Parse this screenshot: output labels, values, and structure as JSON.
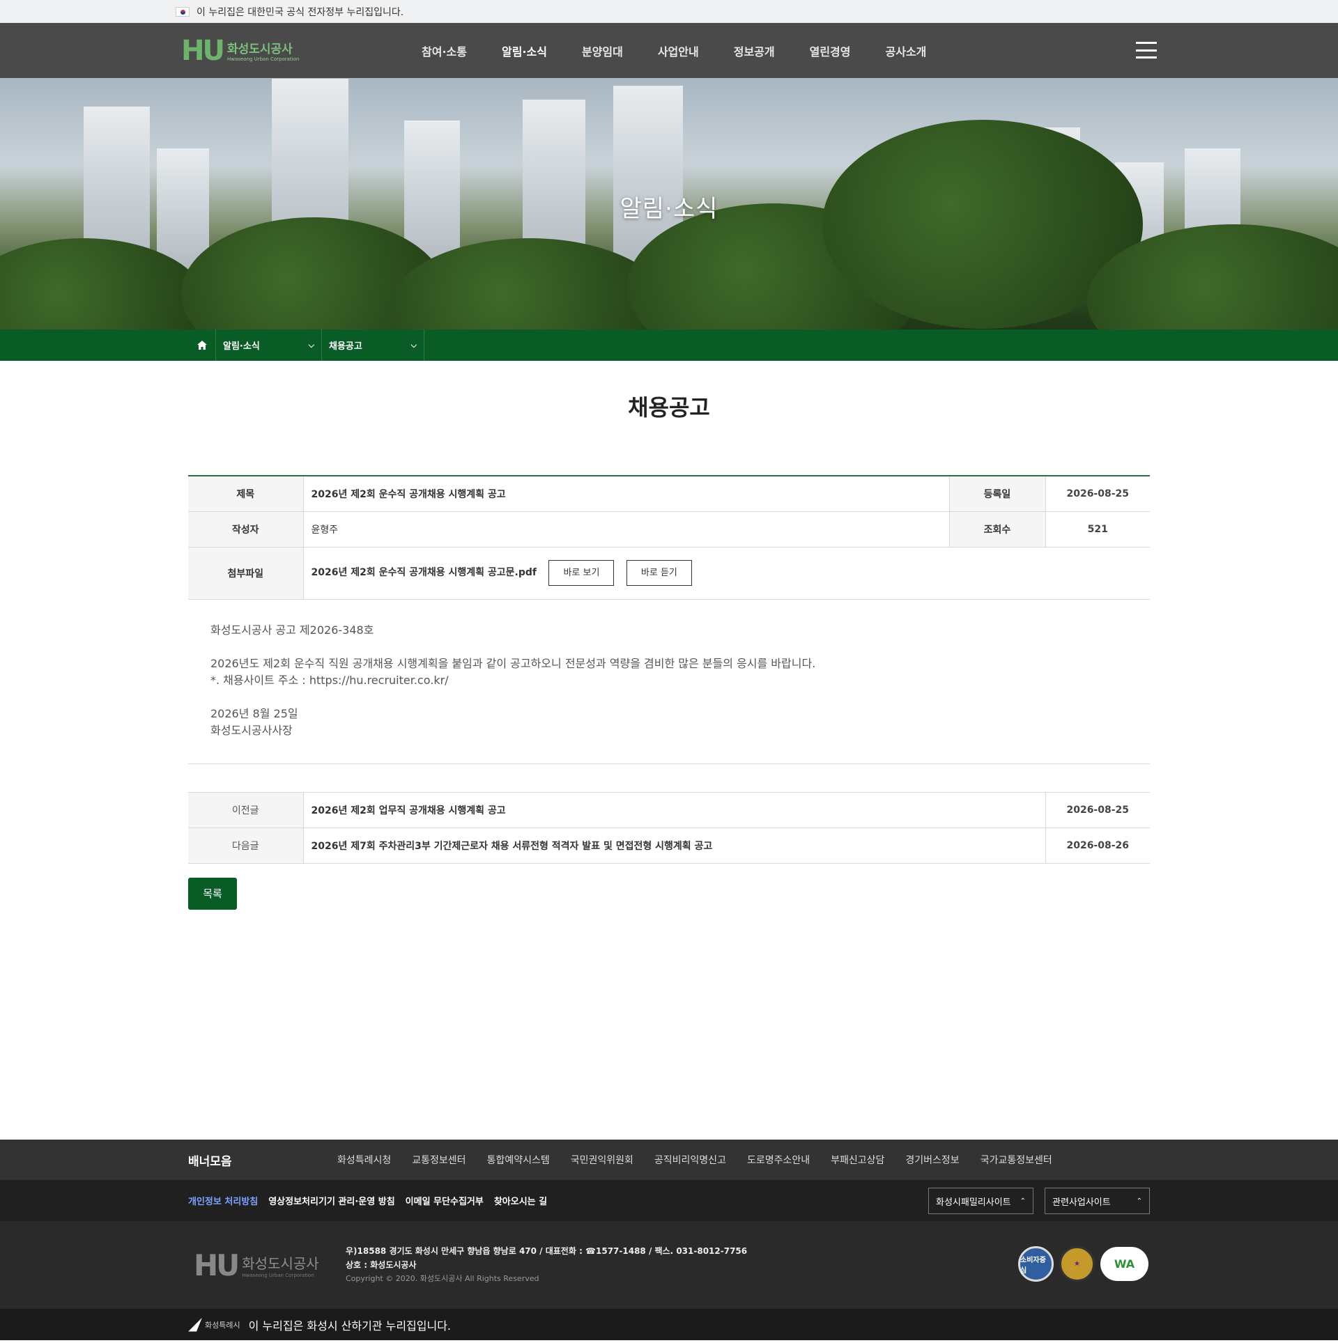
{
  "gov_banner": {
    "text": "이 누리집은 대한민국 공식 전자정부 누리집입니다."
  },
  "header": {
    "logo_mark": "HU",
    "logo_ko": "화성도시공사",
    "logo_en": "Hwaseong Urban Corporation",
    "menu": [
      "참여·소통",
      "알림·소식",
      "분양임대",
      "사업안내",
      "정보공개",
      "열린경영",
      "공사소개"
    ],
    "active_menu": "알림·소식"
  },
  "hero": {
    "title": "알림·소식"
  },
  "location": {
    "level1": "알림·소식",
    "level2": "채용공고"
  },
  "page_title": "채용공고",
  "post": {
    "labels": {
      "title": "제목",
      "date": "등록일",
      "author": "작성자",
      "views": "조회수",
      "attachment": "첨부파일"
    },
    "title": "2026년 제2회 운수직 공개채용 시행계획 공고",
    "date": "2026-08-25",
    "author": "윤형주",
    "views": "521",
    "attachment_name": "2026년 제2회 운수직 공개채용 시행계획 공고문.pdf",
    "btn_view": "바로 보기",
    "btn_listen": "바로 듣기",
    "body": {
      "line1": "화성도시공사 공고 제2026-348호",
      "line2": "2026년도 제2회 운수직 직원 공개채용 시행계획을 붙임과 같이 공고하오니 전문성과 역량을 겸비한 많은 분들의 응시를 바랍니다.",
      "line3": "*. 채용사이트 주소 : https://hu.recruiter.co.kr/",
      "line4": "2026년 8월 25일",
      "line5": "화성도시공사사장"
    }
  },
  "nav": {
    "prev_label": "이전글",
    "prev_title": "2026년 제2회 업무직 공개채용 시행계획 공고",
    "prev_date": "2026-08-25",
    "next_label": "다음글",
    "next_title": "2026년 제7회 주차관리3부 기간제근로자 채용 서류전형 적격자 발표 및 면접전형 시행계획 공고",
    "next_date": "2026-08-26"
  },
  "list_button": "목록",
  "footer": {
    "banner_title": "배너모음",
    "banners": [
      "화성특례시청",
      "교통정보센터",
      "통합예약시스템",
      "국민권익위원회",
      "공직비리익명신고",
      "도로명주소안내",
      "부패신고상담",
      "경기버스정보",
      "국가교통정보센터"
    ],
    "policies": [
      "개인정보 처리방침",
      "영상정보처리기기 관리·운영 방침",
      "이메일 무단수집거부",
      "찾아오시는 길"
    ],
    "family_site": "화성시패밀리사이트",
    "related_site": "관련사업사이트",
    "logo_ko": "화성도시공사",
    "logo_en": "Hwaseong Urban Corporation",
    "address": "우)18588 경기도 화성시 만세구 향남읍 향남로 470 / 대표전화 : ☎1577-1488 / 팩스. 031-8012-7756",
    "company": "상호 : 화성도시공사",
    "copyright": "Copyright © 2020. 화성도시공사 All Rights Reserved",
    "mark1": "소비자중심",
    "mark3": "WA",
    "city_name": "화성특례시",
    "bottom_text": "이 누리집은 화성시 산하기관 누리집입니다."
  }
}
